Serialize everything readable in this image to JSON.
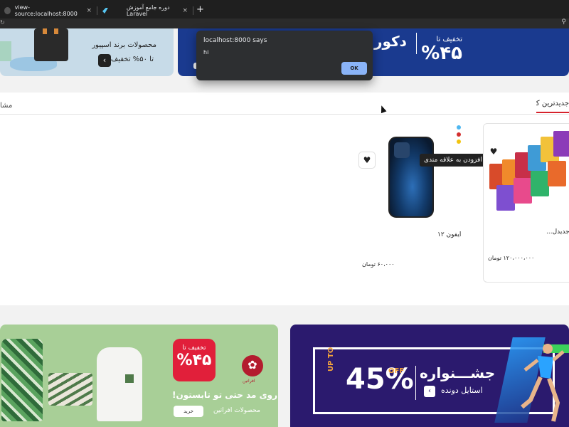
{
  "browser": {
    "tabs": [
      {
        "title": "view-source:localhost:8000",
        "close": "×"
      },
      {
        "title": "دوره جامع آموزش Laravel",
        "close": "×"
      }
    ],
    "new_tab": "+"
  },
  "alert": {
    "title": "localhost:8000 says",
    "message": "hi",
    "ok_label": "OK"
  },
  "top_banners": {
    "left": {
      "line1": "محصولات برند اسپیور",
      "line2": "تا ۵۰% تخفیف",
      "arrow": "‹"
    },
    "right": {
      "discount_label": "تخفیف تا",
      "discount_value": "%۴۵",
      "text": "دکور"
    }
  },
  "products": {
    "tabs": {
      "newest": "جدیدترین کالاها",
      "other": "مشا"
    },
    "wishlist_tooltip": "افزودن به علاقه مندی",
    "heart": "♥",
    "items": [
      {
        "name": "ایفون ۱۲",
        "price": "۶۰،۰۰۰ تومان",
        "colors": [
          "#4fb7f0",
          "#d32f2f",
          "#f2c40f"
        ]
      },
      {
        "name": "جدیدل...",
        "price": "۱۲۰،۰۰۰،۰۰۰ تومان"
      }
    ]
  },
  "bottom_banners": {
    "left": {
      "badge_label": "تخفیف تا",
      "badge_value": "%۴۵",
      "logo_text": "افراتین",
      "slogan": "روی مد حتی تو تابستون!",
      "brand": "محصولات افراتین",
      "cta": "خرید"
    },
    "right": {
      "up_to": "UP TO",
      "percent": "45%",
      "off": "OFF",
      "festival": "جشـــنواره",
      "style": "استایل دونده",
      "arrow": "‹"
    }
  },
  "colors": {
    "accent_red": "#d6222c",
    "dialog_button": "#8ab4f8"
  }
}
